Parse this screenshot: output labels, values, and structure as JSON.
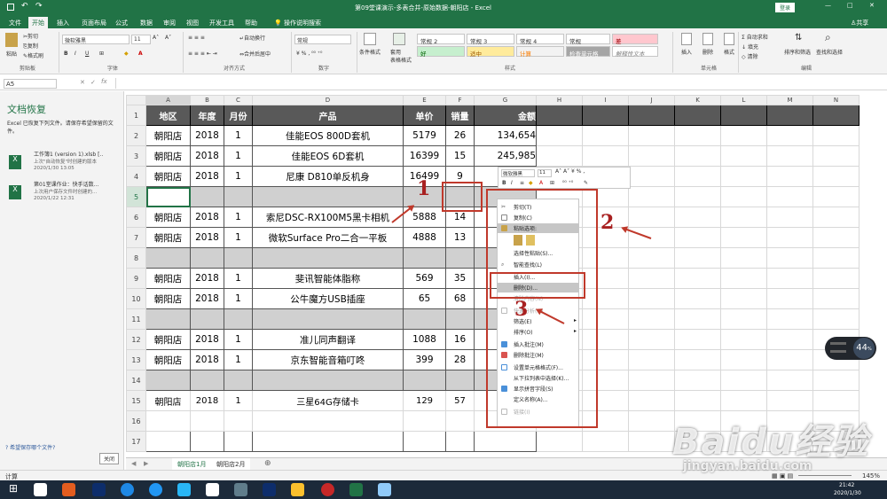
{
  "titlebar": {
    "title": "第09堂课演示-多表合并-原始数据-朝阳店 - Excel",
    "login": "登录"
  },
  "tabs": [
    "文件",
    "开始",
    "插入",
    "页面布局",
    "公式",
    "数据",
    "审阅",
    "视图",
    "开发工具",
    "帮助"
  ],
  "tell_me": "操作说明搜索",
  "share": "共享",
  "ribbon": {
    "paste": "粘贴",
    "cut": "剪切",
    "copy": "复制",
    "format_painter": "格式刷",
    "clipboard": "剪贴板",
    "font_name": "微软雅黑",
    "font_size": "11",
    "font_group": "字体",
    "wrap": "自动换行",
    "merge": "合并后居中",
    "align_group": "对齐方式",
    "number_format": "常规",
    "number_group": "数字",
    "cond_format": "条件格式",
    "table_format": "套用\n表格格式",
    "styles": [
      "常规 2",
      "常规 3",
      "常规 4",
      "常规",
      "差",
      "好",
      "适中",
      "计算",
      "检查单元格",
      "解释性文本"
    ],
    "style_group": "样式",
    "insert": "插入",
    "delete": "删除",
    "format": "格式",
    "cells_group": "单元格",
    "autosum": "自动求和",
    "fill": "填充",
    "clear": "清除",
    "sort": "排序和筛选",
    "find": "查找和选择",
    "edit_group": "编辑"
  },
  "namebox": "A5",
  "recovery": {
    "title": "文档恢复",
    "desc": "Excel 已恢复下列文件。请保存希望保留的文件。",
    "files": [
      {
        "name": "工作簿1 (version 1).xlsb [..",
        "note": "上次\"自动恢复\"时创建的版本",
        "time": "2020/1/30 13:05"
      },
      {
        "name": "第01堂课作业：快手话数...",
        "note": "上次用户保存文件时创建的...",
        "time": "2020/1/22 12:31"
      }
    ],
    "help": "希望保存哪个文件?",
    "close": "关闭"
  },
  "columns": [
    "A",
    "B",
    "C",
    "D",
    "E",
    "F",
    "G",
    "H",
    "I",
    "J",
    "K",
    "L",
    "M",
    "N"
  ],
  "header": [
    "地区",
    "年度",
    "月份",
    "产品",
    "单价",
    "销量",
    "金额"
  ],
  "rows": [
    [
      "朝阳店",
      "2018",
      "1",
      "佳能EOS 800D套机",
      "5179",
      "26",
      "134,654"
    ],
    [
      "朝阳店",
      "2018",
      "1",
      "佳能EOS 6D套机",
      "16399",
      "15",
      "245,985"
    ],
    [
      "朝阳店",
      "2018",
      "1",
      "尼康 D810单反机身",
      "16499",
      "9",
      ""
    ],
    null,
    [
      "朝阳店",
      "2018",
      "1",
      "索尼DSC-RX100M5黑卡相机",
      "5888",
      "14",
      ""
    ],
    [
      "朝阳店",
      "2018",
      "1",
      "微软Surface Pro二合一平板",
      "4888",
      "13",
      ""
    ],
    null,
    [
      "朝阳店",
      "2018",
      "1",
      "斐讯智能体脂称",
      "569",
      "35",
      ""
    ],
    [
      "朝阳店",
      "2018",
      "1",
      "公牛魔方USB插座",
      "65",
      "68",
      ""
    ],
    null,
    [
      "朝阳店",
      "2018",
      "1",
      "准儿同声翻译",
      "1088",
      "16",
      ""
    ],
    [
      "朝阳店",
      "2018",
      "1",
      "京东智能音箱叮咚",
      "399",
      "28",
      ""
    ],
    null,
    [
      "朝阳店",
      "2018",
      "1",
      "三星64G存储卡",
      "129",
      "57",
      ""
    ],
    null,
    null
  ],
  "sheets": [
    "朝阳店1月",
    "朝阳店2月"
  ],
  "status": {
    "mode": "计算",
    "zoom": "145%"
  },
  "minibar": {
    "font": "微软雅黑",
    "size": "11"
  },
  "menu": {
    "cut": "剪切(T)",
    "copy": "复制(C)",
    "paste_options": "粘贴选项:",
    "paste_special": "选择性粘贴(S)...",
    "smart_lookup": "智能查找(L)",
    "insert": "插入(I)...",
    "delete": "删除(D)...",
    "clear": "清除内容(N)",
    "quick": "快速分析(Q)",
    "filter": "筛选(E)",
    "sort": "排序(O)",
    "insert_comment": "插入批注(M)",
    "delete_comment": "删除批注(M)",
    "format_cells": "设置单元格格式(F)...",
    "pick_list": "从下拉列表中选择(K)...",
    "phonetic": "显示拼音字段(S)",
    "define_name": "定义名称(A)...",
    "link": "链接(I)"
  },
  "annotations": [
    "1",
    "2",
    "3"
  ],
  "speed": {
    "value": "44",
    "unit": "%"
  },
  "taskbar": {
    "time": "21:42",
    "date": "2020/1/30"
  },
  "watermark": {
    "brand": "Baidu经验",
    "url": "jingyan.baidu.com"
  }
}
